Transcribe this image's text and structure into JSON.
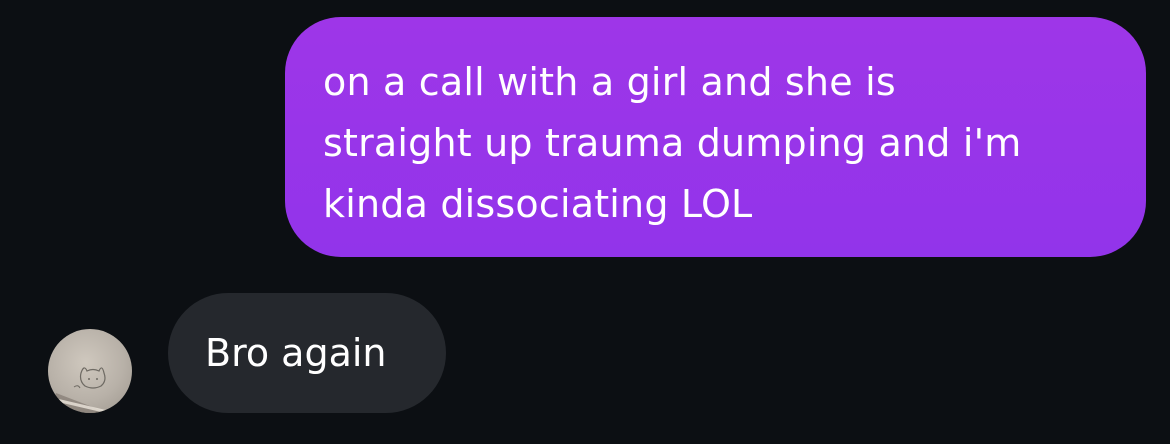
{
  "conversation": {
    "outgoing": {
      "text": "on a call with a girl and she is\nstraight up trauma dumping and i'm\nkinda dissociating LOL"
    },
    "incoming": {
      "text": "Bro again",
      "avatar_icon": "contact-avatar-photo"
    }
  },
  "colors": {
    "background": "#0c0f13",
    "outgoing_bubble": "#9a35e9",
    "incoming_bubble": "#25282d",
    "text": "#ffffff"
  }
}
